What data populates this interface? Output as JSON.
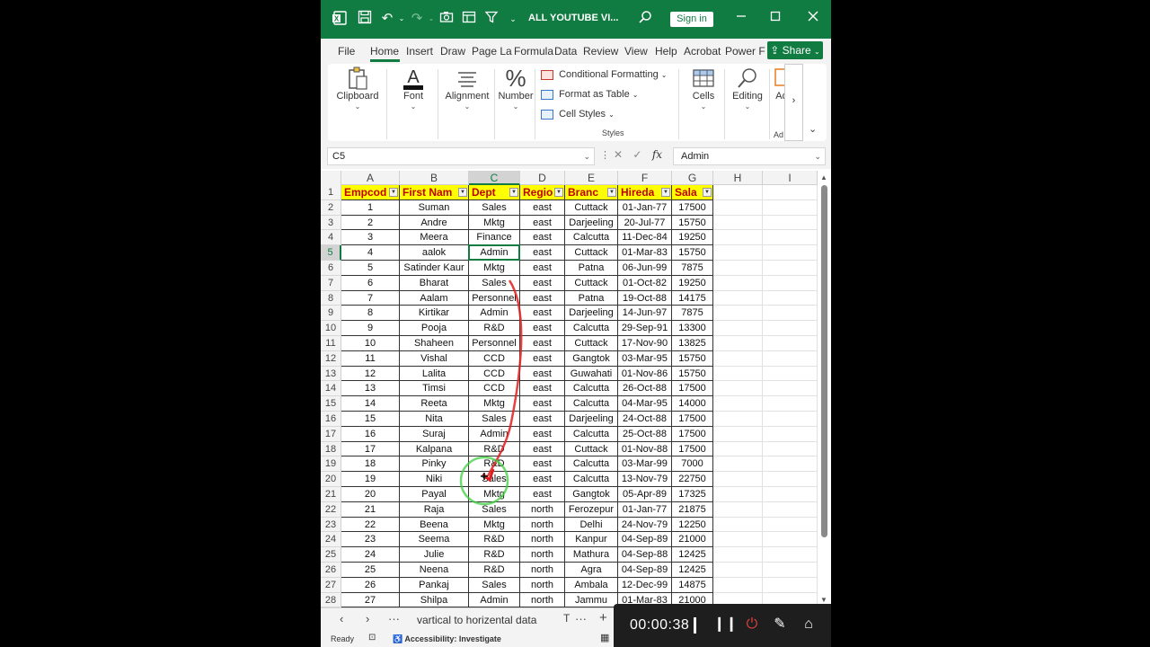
{
  "window": {
    "title": "ALL YOUTUBE VI...",
    "signin_label": "Sign in"
  },
  "tabs": [
    "File",
    "Home",
    "Insert",
    "Draw",
    "Page La",
    "Formula",
    "Data",
    "Review",
    "View",
    "Help",
    "Acrobat",
    "Power F"
  ],
  "share_label": "Share",
  "ribbon": {
    "clipboard": "Clipboard",
    "font": "Font",
    "alignment": "Alignment",
    "number": "Number",
    "cond_format": "Conditional Formatting",
    "format_table": "Format as Table",
    "cell_styles": "Cell Styles",
    "styles_group": "Styles",
    "cells": "Cells",
    "editing": "Editing",
    "addins": "Ad",
    "addins_group": "Ad"
  },
  "formula_bar": {
    "name_box": "C5",
    "value": "Admin"
  },
  "grid": {
    "columns": [
      "A",
      "B",
      "C",
      "D",
      "E",
      "F",
      "G",
      "H",
      "I"
    ],
    "selected_column": "C",
    "selected_row": 5,
    "header": [
      "Empcod",
      "First Nam",
      "Dept",
      "Regio",
      "Branc",
      "Hireda",
      "Sala"
    ],
    "rows": [
      [
        "1",
        "Suman",
        "Sales",
        "east",
        "Cuttack",
        "01-Jan-77",
        "17500"
      ],
      [
        "2",
        "Andre",
        "Mktg",
        "east",
        "Darjeeling",
        "20-Jul-77",
        "15750"
      ],
      [
        "3",
        "Meera",
        "Finance",
        "east",
        "Calcutta",
        "11-Dec-84",
        "19250"
      ],
      [
        "4",
        "aalok",
        "Admin",
        "east",
        "Cuttack",
        "01-Mar-83",
        "15750"
      ],
      [
        "5",
        "Satinder Kaur",
        "Mktg",
        "east",
        "Patna",
        "06-Jun-99",
        "7875"
      ],
      [
        "6",
        "Bharat",
        "Sales",
        "east",
        "Cuttack",
        "01-Oct-82",
        "19250"
      ],
      [
        "7",
        "Aalam",
        "Personnel",
        "east",
        "Patna",
        "19-Oct-88",
        "14175"
      ],
      [
        "8",
        "Kirtikar",
        "Admin",
        "east",
        "Darjeeling",
        "14-Jun-97",
        "7875"
      ],
      [
        "9",
        "Pooja",
        "R&D",
        "east",
        "Calcutta",
        "29-Sep-91",
        "13300"
      ],
      [
        "10",
        "Shaheen",
        "Personnel",
        "east",
        "Cuttack",
        "17-Nov-90",
        "13825"
      ],
      [
        "11",
        "Vishal",
        "CCD",
        "east",
        "Gangtok",
        "03-Mar-95",
        "15750"
      ],
      [
        "12",
        "Lalita",
        "CCD",
        "east",
        "Guwahati",
        "01-Nov-86",
        "15750"
      ],
      [
        "13",
        "Timsi",
        "CCD",
        "east",
        "Calcutta",
        "26-Oct-88",
        "17500"
      ],
      [
        "14",
        "Reeta",
        "Mktg",
        "east",
        "Calcutta",
        "04-Mar-95",
        "14000"
      ],
      [
        "15",
        "Nita",
        "Sales",
        "east",
        "Darjeeling",
        "24-Oct-88",
        "17500"
      ],
      [
        "16",
        "Suraj",
        "Admin",
        "east",
        "Calcutta",
        "25-Oct-88",
        "17500"
      ],
      [
        "17",
        "Kalpana",
        "R&D",
        "east",
        "Cuttack",
        "01-Nov-88",
        "17500"
      ],
      [
        "18",
        "Pinky",
        "R&D",
        "east",
        "Calcutta",
        "03-Mar-99",
        "7000"
      ],
      [
        "19",
        "Niki",
        "Sales",
        "east",
        "Calcutta",
        "13-Nov-79",
        "22750"
      ],
      [
        "20",
        "Payal",
        "Mktg",
        "east",
        "Gangtok",
        "05-Apr-89",
        "17325"
      ],
      [
        "21",
        "Raja",
        "Sales",
        "north",
        "Ferozepur",
        "01-Jan-77",
        "21875"
      ],
      [
        "22",
        "Beena",
        "Mktg",
        "north",
        "Delhi",
        "24-Nov-79",
        "12250"
      ],
      [
        "23",
        "Seema",
        "R&D",
        "north",
        "Kanpur",
        "04-Sep-89",
        "21000"
      ],
      [
        "24",
        "Julie",
        "R&D",
        "north",
        "Mathura",
        "04-Sep-88",
        "12425"
      ],
      [
        "25",
        "Neena",
        "R&D",
        "north",
        "Agra",
        "04-Sep-89",
        "12425"
      ],
      [
        "26",
        "Pankaj",
        "Sales",
        "north",
        "Ambala",
        "12-Dec-99",
        "14875"
      ],
      [
        "27",
        "Shilpa",
        "Admin",
        "north",
        "Jammu",
        "01-Mar-83",
        "21000"
      ]
    ]
  },
  "sheet": {
    "name": "vartical to horizental data",
    "extra": "T"
  },
  "status": {
    "ready": "Ready",
    "accessibility": "Accessibility: Investigate"
  },
  "recorder": {
    "time": "00:00:38"
  },
  "colors": {
    "excel_green": "#107c41",
    "header_fill": "#ffff00",
    "header_text": "#c00000",
    "annotation_red": "#e02020",
    "annotation_green": "#3ecf3e"
  }
}
